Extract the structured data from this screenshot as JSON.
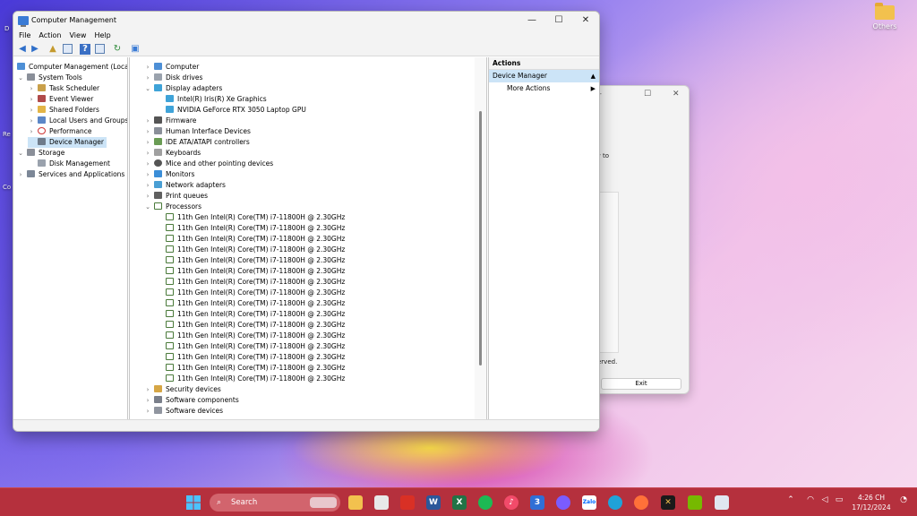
{
  "desktop": {
    "icons": [
      {
        "label": "Others"
      }
    ],
    "edge_texts": [
      "D",
      "Re",
      "Co"
    ]
  },
  "about_dialog": {
    "line1": "w to",
    "line2": "erved.",
    "exit_label": "Exit",
    "close_glyph": "✕",
    "max_glyph": "☐",
    "min_glyph": "—"
  },
  "window": {
    "title": "Computer Management",
    "min_glyph": "—",
    "max_glyph": "☐",
    "close_glyph": "✕"
  },
  "menu": [
    "File",
    "Action",
    "View",
    "Help"
  ],
  "tree": {
    "root": "Computer Management (Local)",
    "system_tools": "System Tools",
    "task_scheduler": "Task Scheduler",
    "event_viewer": "Event Viewer",
    "shared_folders": "Shared Folders",
    "local_users": "Local Users and Groups",
    "performance": "Performance",
    "device_manager": "Device Manager",
    "storage": "Storage",
    "disk_management": "Disk Management",
    "services": "Services and Applications"
  },
  "devices": {
    "computer": "Computer",
    "disk_drives": "Disk drives",
    "display_adapters": "Display adapters",
    "intel_gpu": "Intel(R) Iris(R) Xe Graphics",
    "nvidia_gpu": "NVIDIA GeForce RTX 3050 Laptop GPU",
    "firmware": "Firmware",
    "hid": "Human Interface Devices",
    "ide": "IDE ATA/ATAPI controllers",
    "keyboards": "Keyboards",
    "mice": "Mice and other pointing devices",
    "monitors": "Monitors",
    "network": "Network adapters",
    "print_queues": "Print queues",
    "processors": "Processors",
    "processor_items": [
      "11th Gen Intel(R) Core(TM) i7-11800H @ 2.30GHz",
      "11th Gen Intel(R) Core(TM) i7-11800H @ 2.30GHz",
      "11th Gen Intel(R) Core(TM) i7-11800H @ 2.30GHz",
      "11th Gen Intel(R) Core(TM) i7-11800H @ 2.30GHz",
      "11th Gen Intel(R) Core(TM) i7-11800H @ 2.30GHz",
      "11th Gen Intel(R) Core(TM) i7-11800H @ 2.30GHz",
      "11th Gen Intel(R) Core(TM) i7-11800H @ 2.30GHz",
      "11th Gen Intel(R) Core(TM) i7-11800H @ 2.30GHz",
      "11th Gen Intel(R) Core(TM) i7-11800H @ 2.30GHz",
      "11th Gen Intel(R) Core(TM) i7-11800H @ 2.30GHz",
      "11th Gen Intel(R) Core(TM) i7-11800H @ 2.30GHz",
      "11th Gen Intel(R) Core(TM) i7-11800H @ 2.30GHz",
      "11th Gen Intel(R) Core(TM) i7-11800H @ 2.30GHz",
      "11th Gen Intel(R) Core(TM) i7-11800H @ 2.30GHz",
      "11th Gen Intel(R) Core(TM) i7-11800H @ 2.30GHz",
      "11th Gen Intel(R) Core(TM) i7-11800H @ 2.30GHz"
    ],
    "security": "Security devices",
    "software_components": "Software components",
    "software_devices": "Software devices"
  },
  "actions": {
    "header": "Actions",
    "section": "Device Manager",
    "more": "More Actions"
  },
  "taskbar": {
    "search_label": "Search",
    "clock_time": "4:26 CH",
    "clock_date": "17/12/2024",
    "colors": {
      "bar": "#b5303d",
      "accent": "#cce4f7"
    }
  }
}
